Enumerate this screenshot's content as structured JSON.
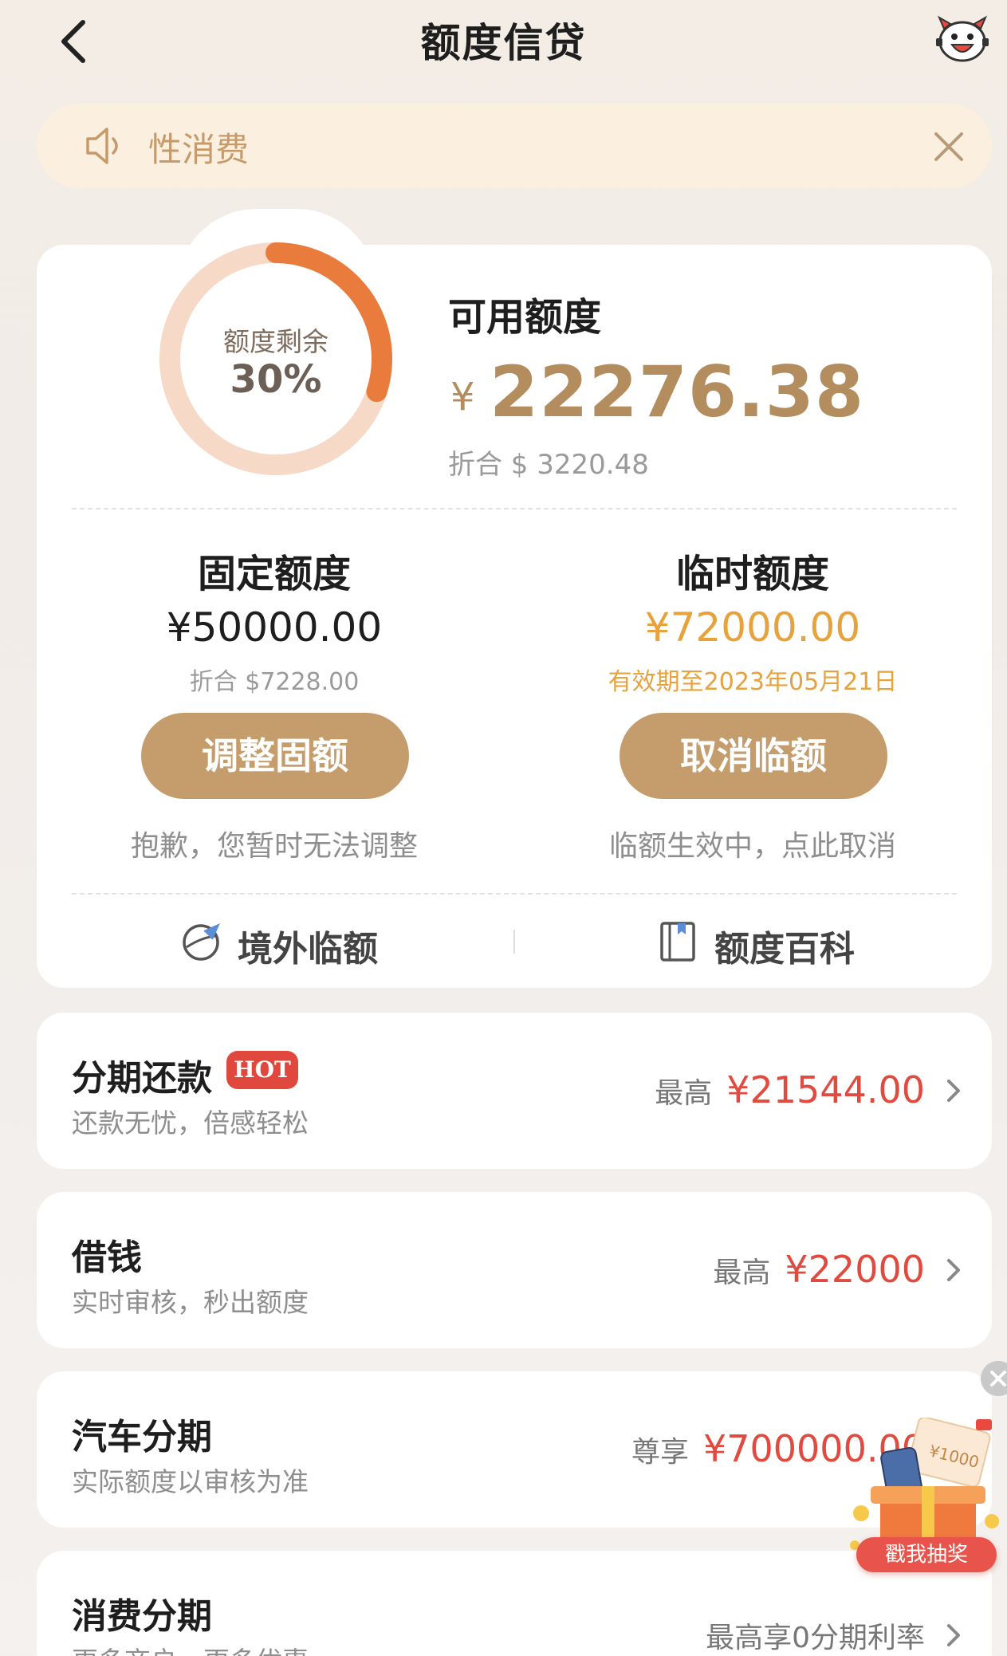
{
  "header": {
    "title": "额度信贷",
    "back_icon": "chevron-left-icon",
    "mascot_icon": "mascot-avatar-icon"
  },
  "notice": {
    "text": "性消费",
    "speaker_icon": "speaker-icon",
    "close_icon": "close-icon"
  },
  "summary": {
    "ring_label": "额度剩余",
    "ring_percent": "30%",
    "ring_fraction": 0.3,
    "available_title": "可用额度",
    "currency_symbol": "¥",
    "available_amount": "22276.38",
    "available_usd": "折合 $ 3220.48"
  },
  "fixed": {
    "title": "固定额度",
    "amount": "¥50000.00",
    "sub": "折合 $7228.00",
    "button": "调整固额",
    "note": "抱歉，您暂时无法调整"
  },
  "temporary": {
    "title": "临时额度",
    "amount": "¥72000.00",
    "sub": "有效期至2023年05月21日",
    "button": "取消临额",
    "note": "临额生效中，点此取消"
  },
  "links": {
    "overseas": "境外临额",
    "overseas_icon": "globe-plane-icon",
    "wiki": "额度百科",
    "wiki_icon": "book-icon"
  },
  "services": [
    {
      "title": "分期还款",
      "badge": "HOT",
      "sub": "还款无忧，倍感轻松",
      "prefix": "最高",
      "value": "¥21544.00"
    },
    {
      "title": "借钱",
      "sub": "实时审核，秒出额度",
      "prefix": "最高",
      "value": "¥22000"
    },
    {
      "title": "汽车分期",
      "sub": "实际额度以审核为准",
      "prefix": "尊享",
      "value": "¥700000.00"
    },
    {
      "title": "消费分期",
      "sub": "更多商户，更多优惠",
      "prefix": "最高享0分期利率",
      "value": ""
    }
  ],
  "floating": {
    "lottery_label": "戳我抽奖",
    "lottery_ticket": "¥1000",
    "close_icon": "close-icon"
  },
  "colors": {
    "gold": "#b38d5e",
    "button_gold": "#c59d6c",
    "orange": "#e8a23c",
    "red": "#e14a3f",
    "ring_track": "#f6d9c7",
    "ring_fill": "#e97b3d"
  }
}
